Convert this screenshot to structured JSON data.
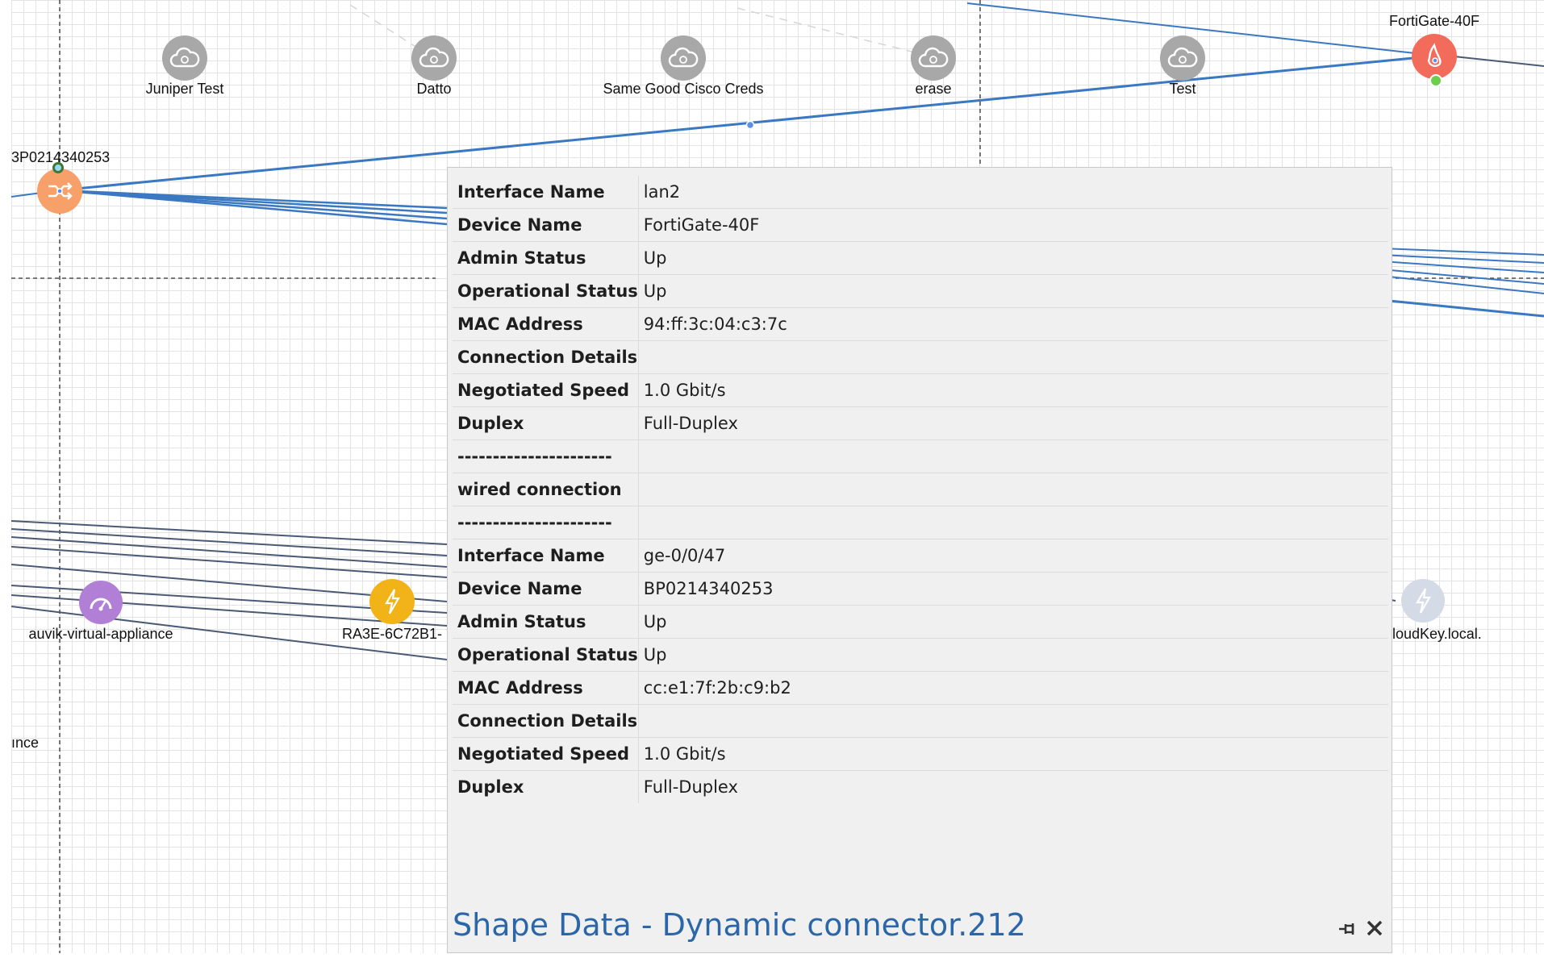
{
  "canvas": {
    "clouds": [
      {
        "label": "Juniper Test",
        "icon": "cloud-icon"
      },
      {
        "label": "Datto",
        "icon": "cloud-icon"
      },
      {
        "label": "Same Good Cisco Creds",
        "icon": "cloud-icon"
      },
      {
        "label": "erase",
        "icon": "cloud-icon"
      },
      {
        "label": "Test",
        "icon": "cloud-icon"
      }
    ],
    "fortigate": {
      "label": "FortiGate-40F",
      "icon": "firewall-icon",
      "color": "#f26b5b"
    },
    "switch": {
      "label": "3P0214340253",
      "icon": "switch-icon",
      "color": "#f7a06a"
    },
    "auvik": {
      "label": "auvik-virtual-appliance",
      "icon": "gauge-icon",
      "color": "#b27fd6"
    },
    "ra3e": {
      "label": "RA3E-6C72B1-",
      "icon": "lightning-icon",
      "color": "#f2b318"
    },
    "cloudkey": {
      "label": "CloudKey.local.",
      "icon": "lightning-icon",
      "color": "#d4dbe6"
    },
    "fragment": {
      "label": "ınce"
    },
    "colors": {
      "link": "#3a78c2",
      "wire": "#4a5a75",
      "grid": "#e3e3e3"
    }
  },
  "panel": {
    "title": "Shape Data - Dynamic connector.212",
    "rows": [
      {
        "key": "Interface Name",
        "value": "lan2"
      },
      {
        "key": "Device Name",
        "value": "FortiGate-40F"
      },
      {
        "key": "Admin Status",
        "value": "Up"
      },
      {
        "key": "Operational Status",
        "value": "Up"
      },
      {
        "key": "MAC Address",
        "value": "94:ff:3c:04:c3:7c"
      },
      {
        "key": "Connection Details",
        "value": ""
      },
      {
        "key": "Negotiated Speed",
        "value": "1.0 Gbit/s"
      },
      {
        "key": "Duplex",
        "value": "Full-Duplex"
      },
      {
        "key": "----------------------",
        "value": ""
      },
      {
        "key": "wired connection",
        "value": ""
      },
      {
        "key": "----------------------",
        "value": ""
      },
      {
        "key": "Interface Name",
        "value": "ge-0/0/47"
      },
      {
        "key": "Device Name",
        "value": "BP0214340253"
      },
      {
        "key": "Admin Status",
        "value": "Up"
      },
      {
        "key": "Operational Status",
        "value": "Up"
      },
      {
        "key": "MAC Address",
        "value": "cc:e1:7f:2b:c9:b2"
      },
      {
        "key": "Connection Details",
        "value": ""
      },
      {
        "key": "Negotiated Speed",
        "value": "1.0 Gbit/s"
      },
      {
        "key": "Duplex",
        "value": "Full-Duplex"
      }
    ],
    "pin_icon": "pin-icon",
    "close_icon": "close-icon"
  }
}
